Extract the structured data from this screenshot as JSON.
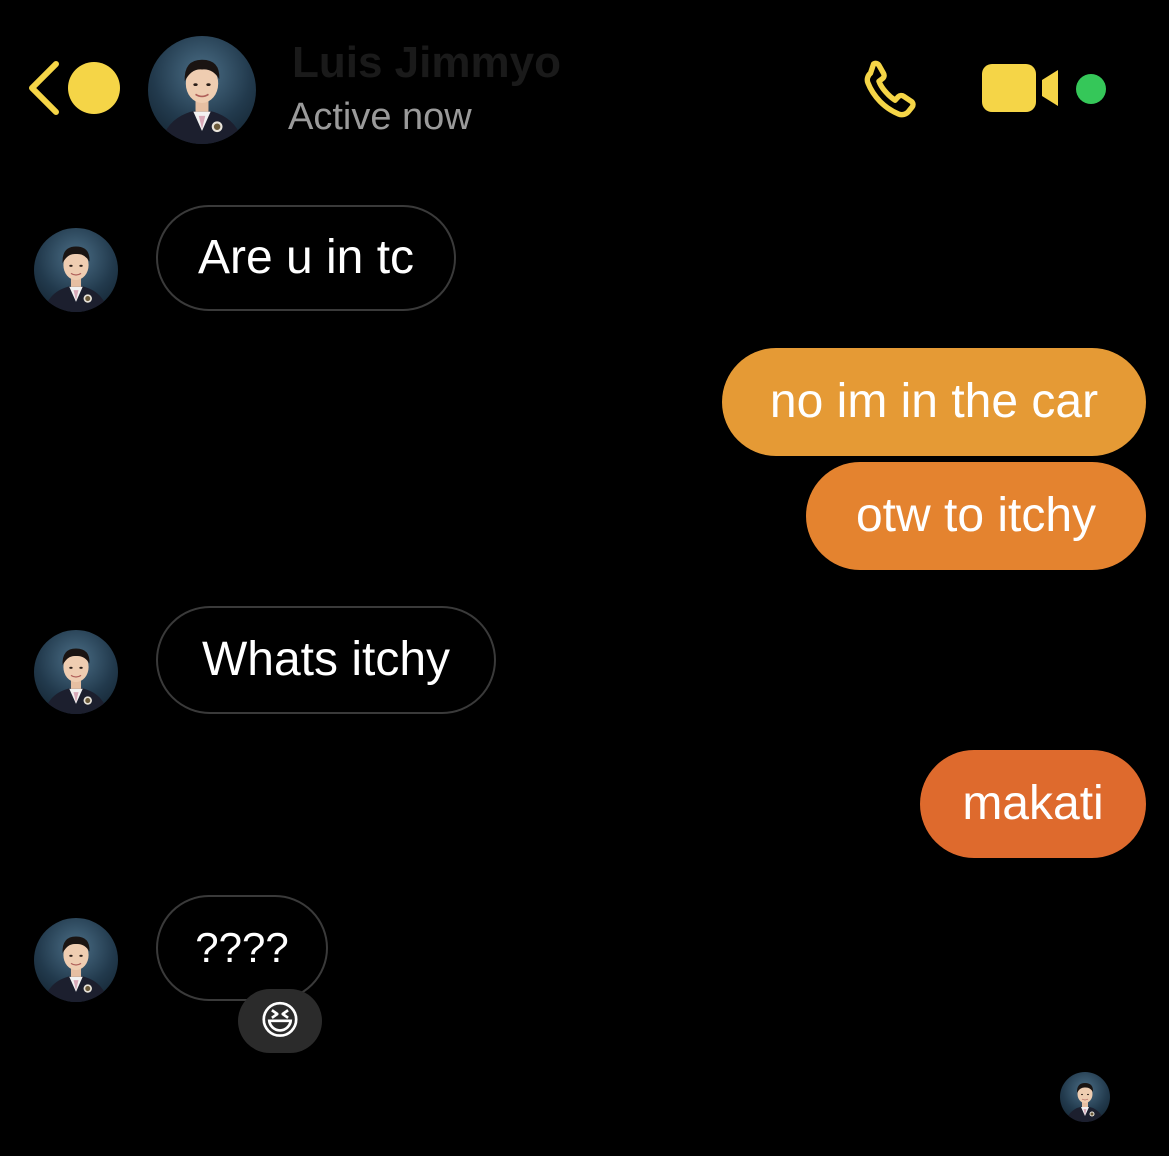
{
  "header": {
    "contact_name": "Luis Jimmyo",
    "status": "Active now",
    "accent_color": "#F5D547",
    "online_color": "#35C759",
    "icons": [
      "chevron-left-icon",
      "phone-icon",
      "video-camera-icon"
    ]
  },
  "messages": [
    {
      "direction": "incoming",
      "text": "Are u in tc"
    },
    {
      "direction": "outgoing",
      "text": "no im in the car",
      "color": "#E59A35"
    },
    {
      "direction": "outgoing",
      "text": "otw to itchy",
      "color": "#E4832F"
    },
    {
      "direction": "incoming",
      "text": "Whats itchy"
    },
    {
      "direction": "outgoing",
      "text": "makati",
      "color": "#DE6A2D"
    },
    {
      "direction": "incoming",
      "text": "????",
      "reaction": "😆"
    }
  ]
}
